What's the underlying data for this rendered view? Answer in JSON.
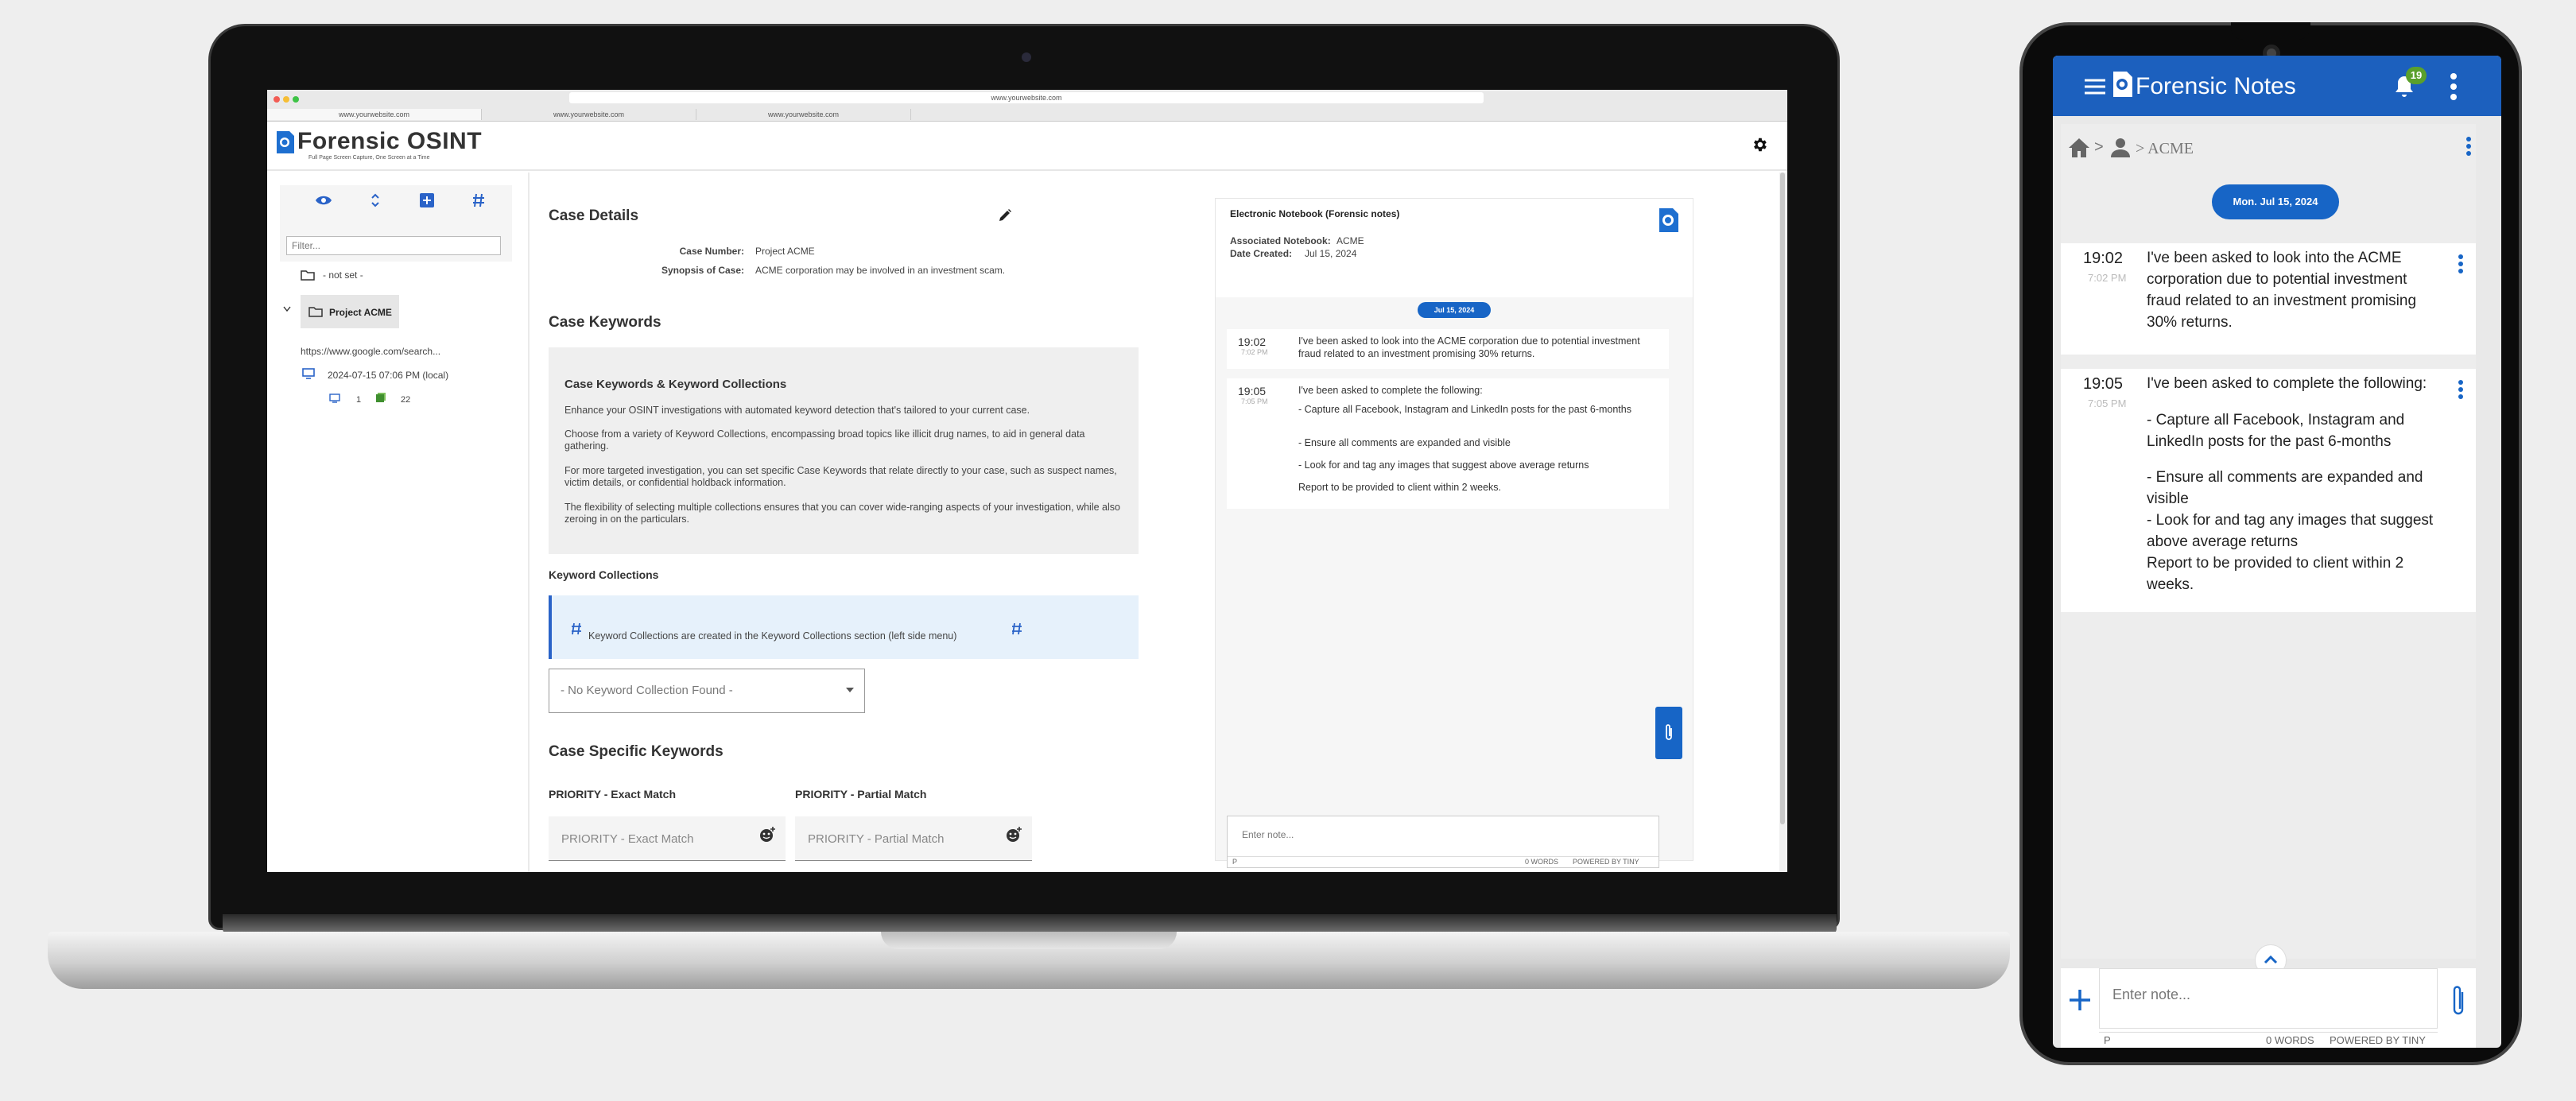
{
  "browser": {
    "url": "www.yourwebsite.com",
    "tabs": [
      "www.yourwebsite.com",
      "www.yourwebsite.com",
      "www.yourwebsite.com"
    ]
  },
  "app": {
    "brand": "Forensic OSINT",
    "tagline": "Full Page Screen Capture, One Screen at a Time"
  },
  "sidebar": {
    "filter_placeholder": "Filter...",
    "tree": {
      "not_set": "- not set -",
      "project": "Project ACME",
      "url": "https://www.google.com/search...",
      "capture": "2024-07-15 07:06 PM (local)",
      "count_a": "1",
      "count_b": "22"
    }
  },
  "case_details": {
    "title": "Case Details",
    "case_number_label": "Case Number:",
    "case_number": "Project ACME",
    "synopsis_label": "Synopsis of Case:",
    "synopsis": "ACME corporation may be involved in an investment scam."
  },
  "case_keywords": {
    "title": "Case Keywords",
    "box_title": "Case Keywords & Keyword Collections",
    "p1": "Enhance your OSINT investigations with automated keyword detection that's tailored to your current case.",
    "p2": "Choose from a variety of Keyword Collections, encompassing broad topics like illicit drug names, to aid in general data gathering.",
    "p3": "For more targeted investigation, you can set specific Case Keywords that relate directly to your case, such as suspect names, victim details, or confidential holdback information.",
    "p4": "The flexibility of selecting multiple collections ensures that you can cover wide-ranging aspects of your investigation, while also zeroing in on the particulars.",
    "collections_label": "Keyword Collections",
    "info": "Keyword Collections are created in the Keyword Collections section (left side menu)",
    "select_value": "- No Keyword Collection Found -",
    "specific_title": "Case Specific Keywords",
    "exact_label": "PRIORITY - Exact Match",
    "exact_placeholder": "PRIORITY - Exact Match",
    "partial_label": "PRIORITY - Partial Match",
    "partial_placeholder": "PRIORITY - Partial Match"
  },
  "notebook": {
    "title": "Electronic Notebook (Forensic notes)",
    "assoc_label": "Associated Notebook:",
    "assoc_value": "ACME",
    "created_label": "Date Created:",
    "created_value": "Jul 15, 2024",
    "date_pill": "Jul 15, 2024",
    "notes": [
      {
        "time": "19:02",
        "sub": "7:02 PM",
        "lines": [
          "I've been asked to look into the ACME corporation due to potential investment fraud related to an investment promising 30% returns."
        ]
      },
      {
        "time": "19:05",
        "sub": "7:05 PM",
        "lines": [
          "I've been asked to complete the following:",
          "- Capture all Facebook, Instagram and LinkedIn posts for the past 6-months",
          "- Ensure all comments are expanded and visible",
          "- Look for and tag any images that suggest above average returns",
          "Report to be provided to client within 2 weeks."
        ]
      }
    ],
    "input_placeholder": "Enter note...",
    "footer_p": "P",
    "footer_words": "0 WORDS",
    "footer_powered": "POWERED BY TINY"
  },
  "phone": {
    "title": "Forensic Notes",
    "badge": "19",
    "breadcrumb": "> ACME",
    "date_pill": "Mon. Jul 15, 2024",
    "notes": [
      {
        "time": "19:02",
        "sub": "7:02 PM",
        "text": "I've been asked to look into the ACME corporation due to potential investment fraud related to an investment promising 30% returns."
      },
      {
        "time": "19:05",
        "sub": "7:05 PM",
        "lead": "I've been asked to complete the following:",
        "item1": "- Capture all Facebook, Instagram and LinkedIn posts for the past 6-months",
        "item2": "- Ensure all comments are expanded and visible",
        "item3": "- Look for and tag any images that suggest above average returns",
        "tail": "Report to be provided to client within 2 weeks."
      }
    ],
    "input_placeholder": "Enter note...",
    "footer_p": "P",
    "footer_words": "0 WORDS",
    "footer_powered": "POWERED BY TINY"
  },
  "colors": {
    "accent": "#1765c6",
    "phone_bar": "#1c60be",
    "badge": "#5aa02c"
  }
}
